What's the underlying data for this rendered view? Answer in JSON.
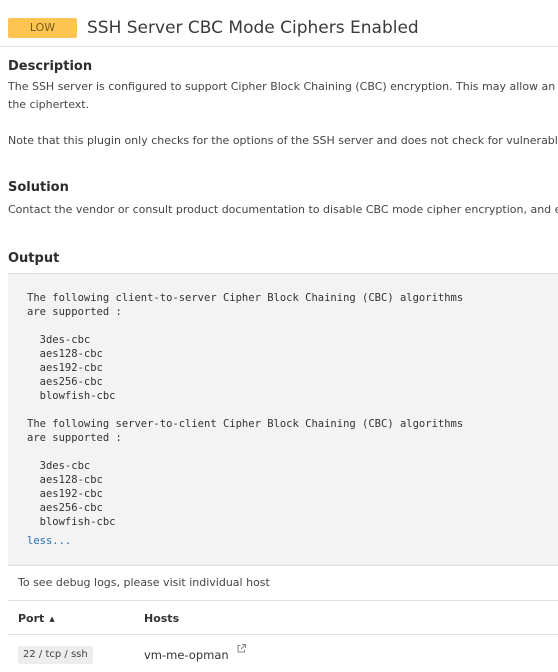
{
  "header": {
    "severity": "LOW",
    "title": "SSH Server CBC Mode Ciphers Enabled"
  },
  "description": {
    "heading": "Description",
    "line1": "The SSH server is configured to support Cipher Block Chaining (CBC) encryption. This may allow an att",
    "line2": "the ciphertext.",
    "line3": "Note that this plugin only checks for the options of the SSH server and does not check for vulnerable"
  },
  "solution": {
    "heading": "Solution",
    "text": "Contact the vendor or consult product documentation to disable CBC mode cipher encryption, and er"
  },
  "output": {
    "heading": "Output",
    "text": "The following client-to-server Cipher Block Chaining (CBC) algorithms\nare supported :\n\n  3des-cbc\n  aes128-cbc\n  aes192-cbc\n  aes256-cbc\n  blowfish-cbc\n\nThe following server-to-client Cipher Block Chaining (CBC) algorithms\nare supported :\n\n  3des-cbc\n  aes128-cbc\n  aes192-cbc\n  aes256-cbc\n  blowfish-cbc",
    "less_link": "less..."
  },
  "debug_note": "To see debug logs, please visit individual host",
  "hosts_table": {
    "columns": [
      "Port",
      "Hosts"
    ],
    "sort_icon": "sort-ascending-icon",
    "rows": [
      {
        "port": "22 / tcp / ssh",
        "host": "vm-me-opman",
        "icon": "external-link-icon"
      }
    ]
  },
  "colors": {
    "severity_low": "#fcc450",
    "link": "#2a6eb5",
    "output_bg": "#f3f3f3"
  }
}
